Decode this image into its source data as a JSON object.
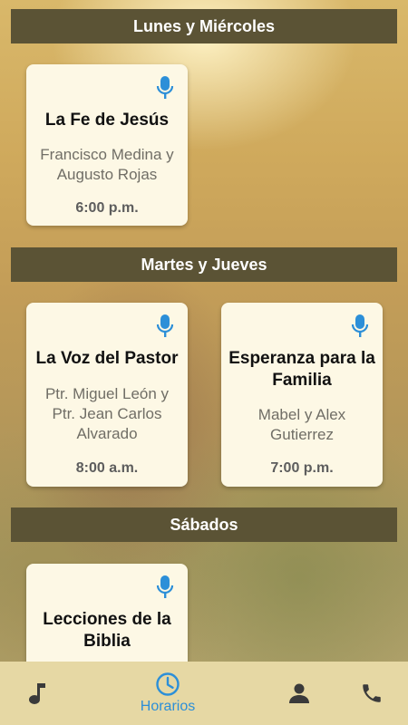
{
  "sections": [
    {
      "title": "Lunes y Miércoles",
      "programs": [
        {
          "title": "La Fe de Jesús",
          "hosts": "Francisco Medina y Augusto Rojas",
          "time": "6:00 p.m."
        }
      ]
    },
    {
      "title": "Martes y Jueves",
      "programs": [
        {
          "title": "La Voz del Pastor",
          "hosts": "Ptr. Miguel León y Ptr. Jean Carlos Alvarado",
          "time": "8:00 a.m."
        },
        {
          "title": "Esperanza para la Familia",
          "hosts": "Mabel y Alex Gutierrez",
          "time": "7:00 p.m."
        }
      ]
    },
    {
      "title": "Sábados",
      "programs": [
        {
          "title": "Lecciones de la Biblia",
          "hosts": "",
          "time": ""
        }
      ]
    }
  ],
  "tabbar": {
    "active_label": "Horarios",
    "tabs": [
      {
        "icon": "music-note-icon"
      },
      {
        "icon": "clock-icon",
        "label": "Horarios"
      },
      {
        "icon": "person-icon"
      },
      {
        "icon": "phone-icon"
      }
    ]
  },
  "colors": {
    "header_bg": "#5b5335",
    "card_bg": "#fdf8e5",
    "mic_blue": "#2c8fd8",
    "tabbar_bg": "#e6d8a4",
    "tab_active": "#2c8fd8",
    "tab_inactive": "#3a3a3a"
  }
}
